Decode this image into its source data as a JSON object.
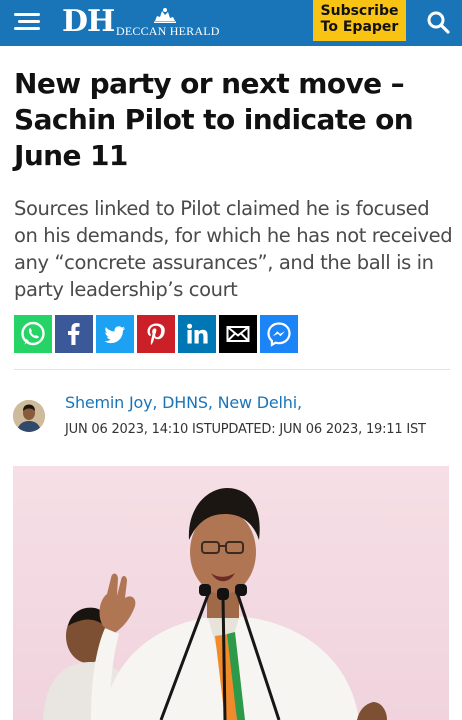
{
  "header": {
    "logo_mark": "DH",
    "logo_name": "DECCAN HERALD",
    "subscribe_line1": "Subscribe",
    "subscribe_line2": "To Epaper",
    "menu_icon": "hamburger-menu-icon",
    "search_icon": "search-icon",
    "bar_color": "#1a75b8",
    "subscribe_color": "#f9c313"
  },
  "article": {
    "headline": "New party or next move – Sachin Pilot to indicate on June 11",
    "summary": "Sources linked to Pilot claimed he is focused on his demands, for which he has not received any “concrete assurances”, and the ball is in party leadership’s court",
    "author": "Shemin Joy, DHNS, New Delhi,",
    "dateline": "JUN 06 2023, 14:10 ISTUPDATED: JUN 06 2023, 19:11 IST"
  },
  "share": [
    {
      "icon": "whatsapp-icon",
      "color": "#25d366"
    },
    {
      "icon": "facebook-icon",
      "color": "#3b5998"
    },
    {
      "icon": "twitter-icon",
      "color": "#1da1f2"
    },
    {
      "icon": "pinterest-icon",
      "color": "#cb2027"
    },
    {
      "icon": "linkedin-icon",
      "color": "#0077b5"
    },
    {
      "icon": "email-icon",
      "color": "#000000"
    },
    {
      "icon": "messenger-icon",
      "color": "#1b85f7"
    }
  ]
}
